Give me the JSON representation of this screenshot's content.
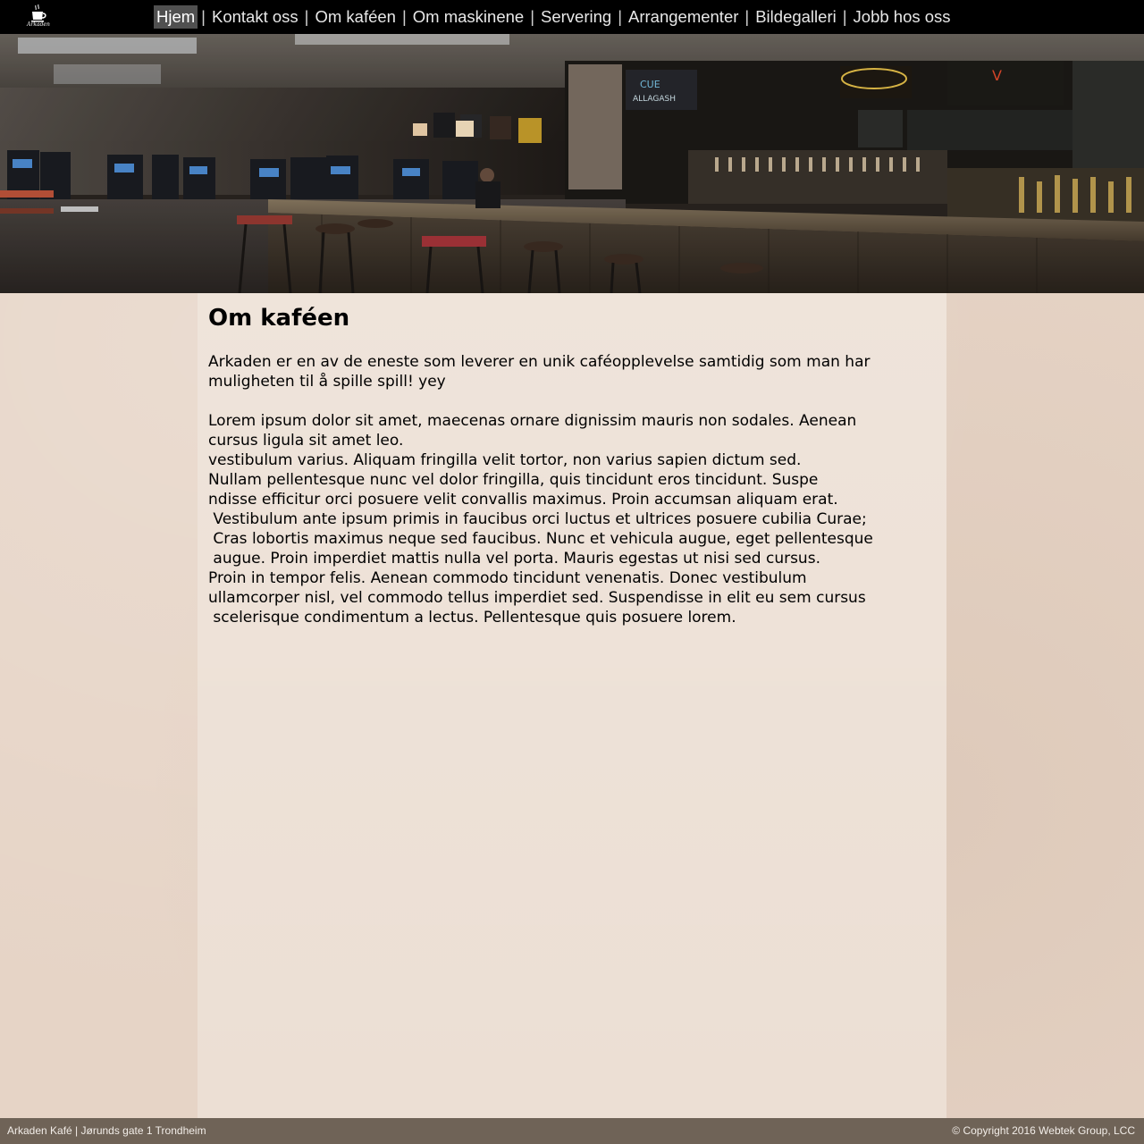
{
  "logo": {
    "text": "Arkaden",
    "icon": "coffee-cup-icon"
  },
  "nav": {
    "items": [
      {
        "label": "Hjem",
        "active": true
      },
      {
        "label": "Kontakt oss",
        "active": false
      },
      {
        "label": "Om kaféen",
        "active": false
      },
      {
        "label": "Om maskinene",
        "active": false
      },
      {
        "label": "Servering",
        "active": false
      },
      {
        "label": "Arrangementer",
        "active": false
      },
      {
        "label": "Bildegalleri",
        "active": false
      },
      {
        "label": "Jobb hos oss",
        "active": false
      }
    ],
    "separator": "|"
  },
  "main": {
    "title": "Om kaféen",
    "intro": "Arkaden er en av de eneste som leverer en unik caféopplevelse samtidig som man har muligheten til å spille spill! yey",
    "lorem_lines": [
      "Lorem ipsum dolor sit amet, maecenas ornare dignissim mauris non sodales. Aenean",
      "cursus ligula sit amet leo.",
      "vestibulum varius. Aliquam fringilla velit tortor, non varius sapien dictum sed.",
      "Nullam pellentesque nunc vel dolor fringilla, quis tincidunt eros tincidunt. Suspe",
      "ndisse efficitur orci posuere velit convallis maximus. Proin accumsan aliquam erat.",
      " Vestibulum ante ipsum primis in faucibus orci luctus et ultrices posuere cubilia Curae;",
      " Cras lobortis maximus neque sed faucibus. Nunc et vehicula augue, eget pellentesque",
      " augue. Proin imperdiet mattis nulla vel porta. Mauris egestas ut nisi sed cursus.",
      "Proin in tempor felis. Aenean commodo tincidunt venenatis. Donec vestibulum",
      "ullamcorper nisl, vel commodo tellus imperdiet sed. Suspendisse in elit eu sem cursus",
      " scelerisque condimentum a lectus. Pellentesque quis posuere lorem."
    ]
  },
  "footer": {
    "left": "Arkaden Kafé | Jørunds gate 1 Trondheim",
    "right": "© Copyright 2016 Webtek Group, LCC"
  },
  "colors": {
    "topbar": "#000000",
    "nav_active_bg": "#505050",
    "page_bg": "#e6d4c6",
    "content_bg": "#ecdfd4",
    "footer_bg": "#6f6357"
  }
}
